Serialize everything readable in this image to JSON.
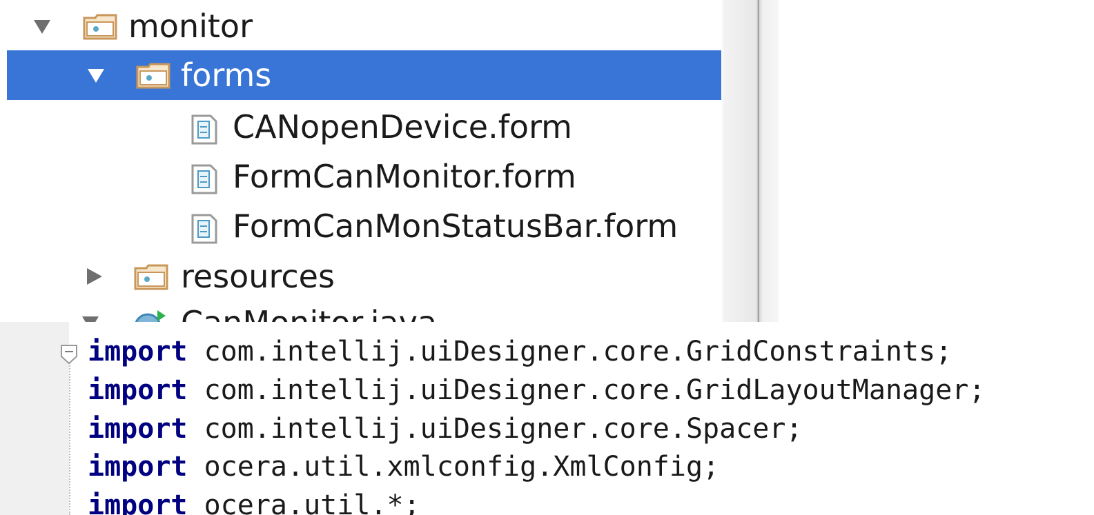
{
  "project_tree": {
    "items": [
      {
        "label": "monitor",
        "kind": "package",
        "expanded": true
      },
      {
        "label": "forms",
        "kind": "package",
        "expanded": true,
        "selected": true
      },
      {
        "label": "CANopenDevice.form",
        "kind": "form-file"
      },
      {
        "label": "FormCanMonitor.form",
        "kind": "form-file"
      },
      {
        "label": "FormCanMonStatusBar.form",
        "kind": "form-file"
      },
      {
        "label": "resources",
        "kind": "package",
        "expanded": false
      },
      {
        "label": "CanMonitor.java",
        "kind": "class-file",
        "partially_visible": true
      }
    ],
    "selection_color": "#3875d7",
    "folder_color": "#d9a86c"
  },
  "editor": {
    "lines": [
      {
        "keyword": "import",
        "text": " com.intellij.uiDesigner.core.GridConstraints;"
      },
      {
        "keyword": "import",
        "text": " com.intellij.uiDesigner.core.GridLayoutManager;"
      },
      {
        "keyword": "import",
        "text": " com.intellij.uiDesigner.core.Spacer;"
      },
      {
        "keyword": "import",
        "text": " ocera.util.xmlconfig.XmlConfig;"
      },
      {
        "keyword": "import",
        "text": " ocera.util.*;"
      }
    ],
    "keyword_color": "#000080"
  }
}
